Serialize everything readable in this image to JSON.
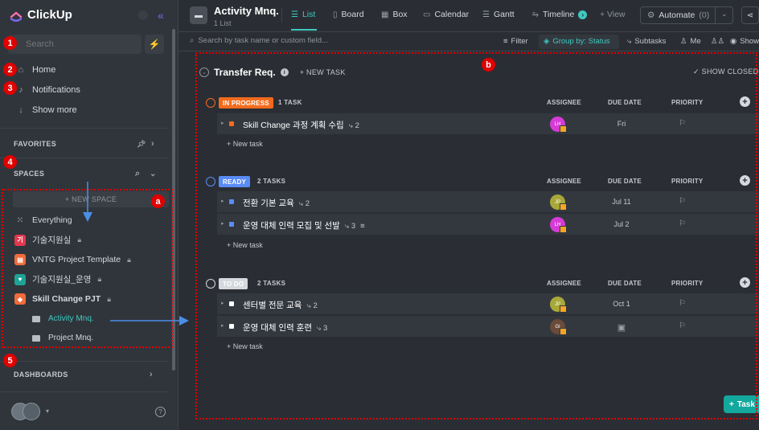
{
  "app": {
    "name": "ClickUp"
  },
  "sidebar": {
    "search_placeholder": "Search",
    "nav": [
      {
        "label": "Home",
        "icon": "home-icon"
      },
      {
        "label": "Notifications",
        "icon": "bell-icon"
      },
      {
        "label": "Show more",
        "icon": "arrow-down-icon"
      }
    ],
    "favorites_label": "FAVORITES",
    "spaces_label": "SPACES",
    "new_space_label": "+ NEW SPACE",
    "spaces": [
      {
        "label": "Everything",
        "badge": "",
        "color": "#3a3f46",
        "locked": false
      },
      {
        "label": "기술지원실",
        "badge": "기",
        "color": "#e5384f",
        "locked": true
      },
      {
        "label": "VNTG Project Template",
        "badge": "▤",
        "color": "#f26b3a",
        "locked": true
      },
      {
        "label": "기술지원실_운영",
        "badge": "♥",
        "color": "#1fa396",
        "locked": true
      },
      {
        "label": "Skill Change PJT",
        "badge": "◈",
        "color": "#f26b3a",
        "locked": true
      }
    ],
    "folders": [
      {
        "label": "Activity Mnq.",
        "active": true
      },
      {
        "label": "Project Mnq.",
        "active": false
      }
    ],
    "dashboards_label": "DASHBOARDS"
  },
  "topbar": {
    "title": "Activity Mnq.",
    "subtitle": "1 List",
    "tabs": [
      {
        "label": "List",
        "icon": "list-icon"
      },
      {
        "label": "Board",
        "icon": "board-icon"
      },
      {
        "label": "Box",
        "icon": "box-icon"
      },
      {
        "label": "Calendar",
        "icon": "calendar-icon"
      },
      {
        "label": "Gantt",
        "icon": "gantt-icon"
      },
      {
        "label": "Timeline",
        "icon": "timeline-icon"
      }
    ],
    "add_view_label": "+ View",
    "automate_label": "Automate",
    "automate_count": "(0)"
  },
  "filterbar": {
    "search_placeholder": "Search by task name or custom field...",
    "filter_label": "Filter",
    "group_by_label": "Group by: Status",
    "subtasks_label": "Subtasks",
    "me_label": "Me",
    "show_label": "Show"
  },
  "list": {
    "name": "Transfer Req.",
    "new_task_label": "+ NEW TASK",
    "show_closed_label": "✓ SHOW CLOSED",
    "columns": {
      "assignee": "ASSIGNEE",
      "due": "DUE DATE",
      "priority": "PRIORITY"
    },
    "new_task_row_label": "+ New task",
    "groups": [
      {
        "status": "IN PROGRESS",
        "color": "#f26b1d",
        "count_label": "1 TASK",
        "tasks": [
          {
            "name": "Skill Change 과정 계획 수립",
            "subtasks": "2",
            "assignee": "LH",
            "assignee_color": "#d63bd6",
            "due": "Fri"
          }
        ]
      },
      {
        "status": "READY",
        "color": "#5a8cf7",
        "count_label": "2 TASKS",
        "tasks": [
          {
            "name": "전환 기본 교육",
            "subtasks": "2",
            "assignee": "JP",
            "assignee_color": "#a8a83a",
            "due": "Jul 11"
          },
          {
            "name": "운영 대체 인력 모집 및 선발",
            "subtasks": "3",
            "assignee": "LH",
            "assignee_color": "#d63bd6",
            "due": "Jul 2"
          }
        ]
      },
      {
        "status": "TO DO",
        "color": "#d5d8dc",
        "count_label": "2 TASKS",
        "tasks": [
          {
            "name": "센터별 전문 교육",
            "subtasks": "2",
            "assignee": "JP",
            "assignee_color": "#a8a83a",
            "due": "Oct 1"
          },
          {
            "name": "운영 대체 인력 훈련",
            "subtasks": "3",
            "assignee": "GI",
            "assignee_color": "#6a4a3a",
            "due": ""
          }
        ]
      }
    ]
  },
  "float_button_label": "Task",
  "annotations": {
    "markers": [
      "1",
      "2",
      "3",
      "4",
      "5"
    ],
    "box_a": "a",
    "box_b": "b"
  }
}
